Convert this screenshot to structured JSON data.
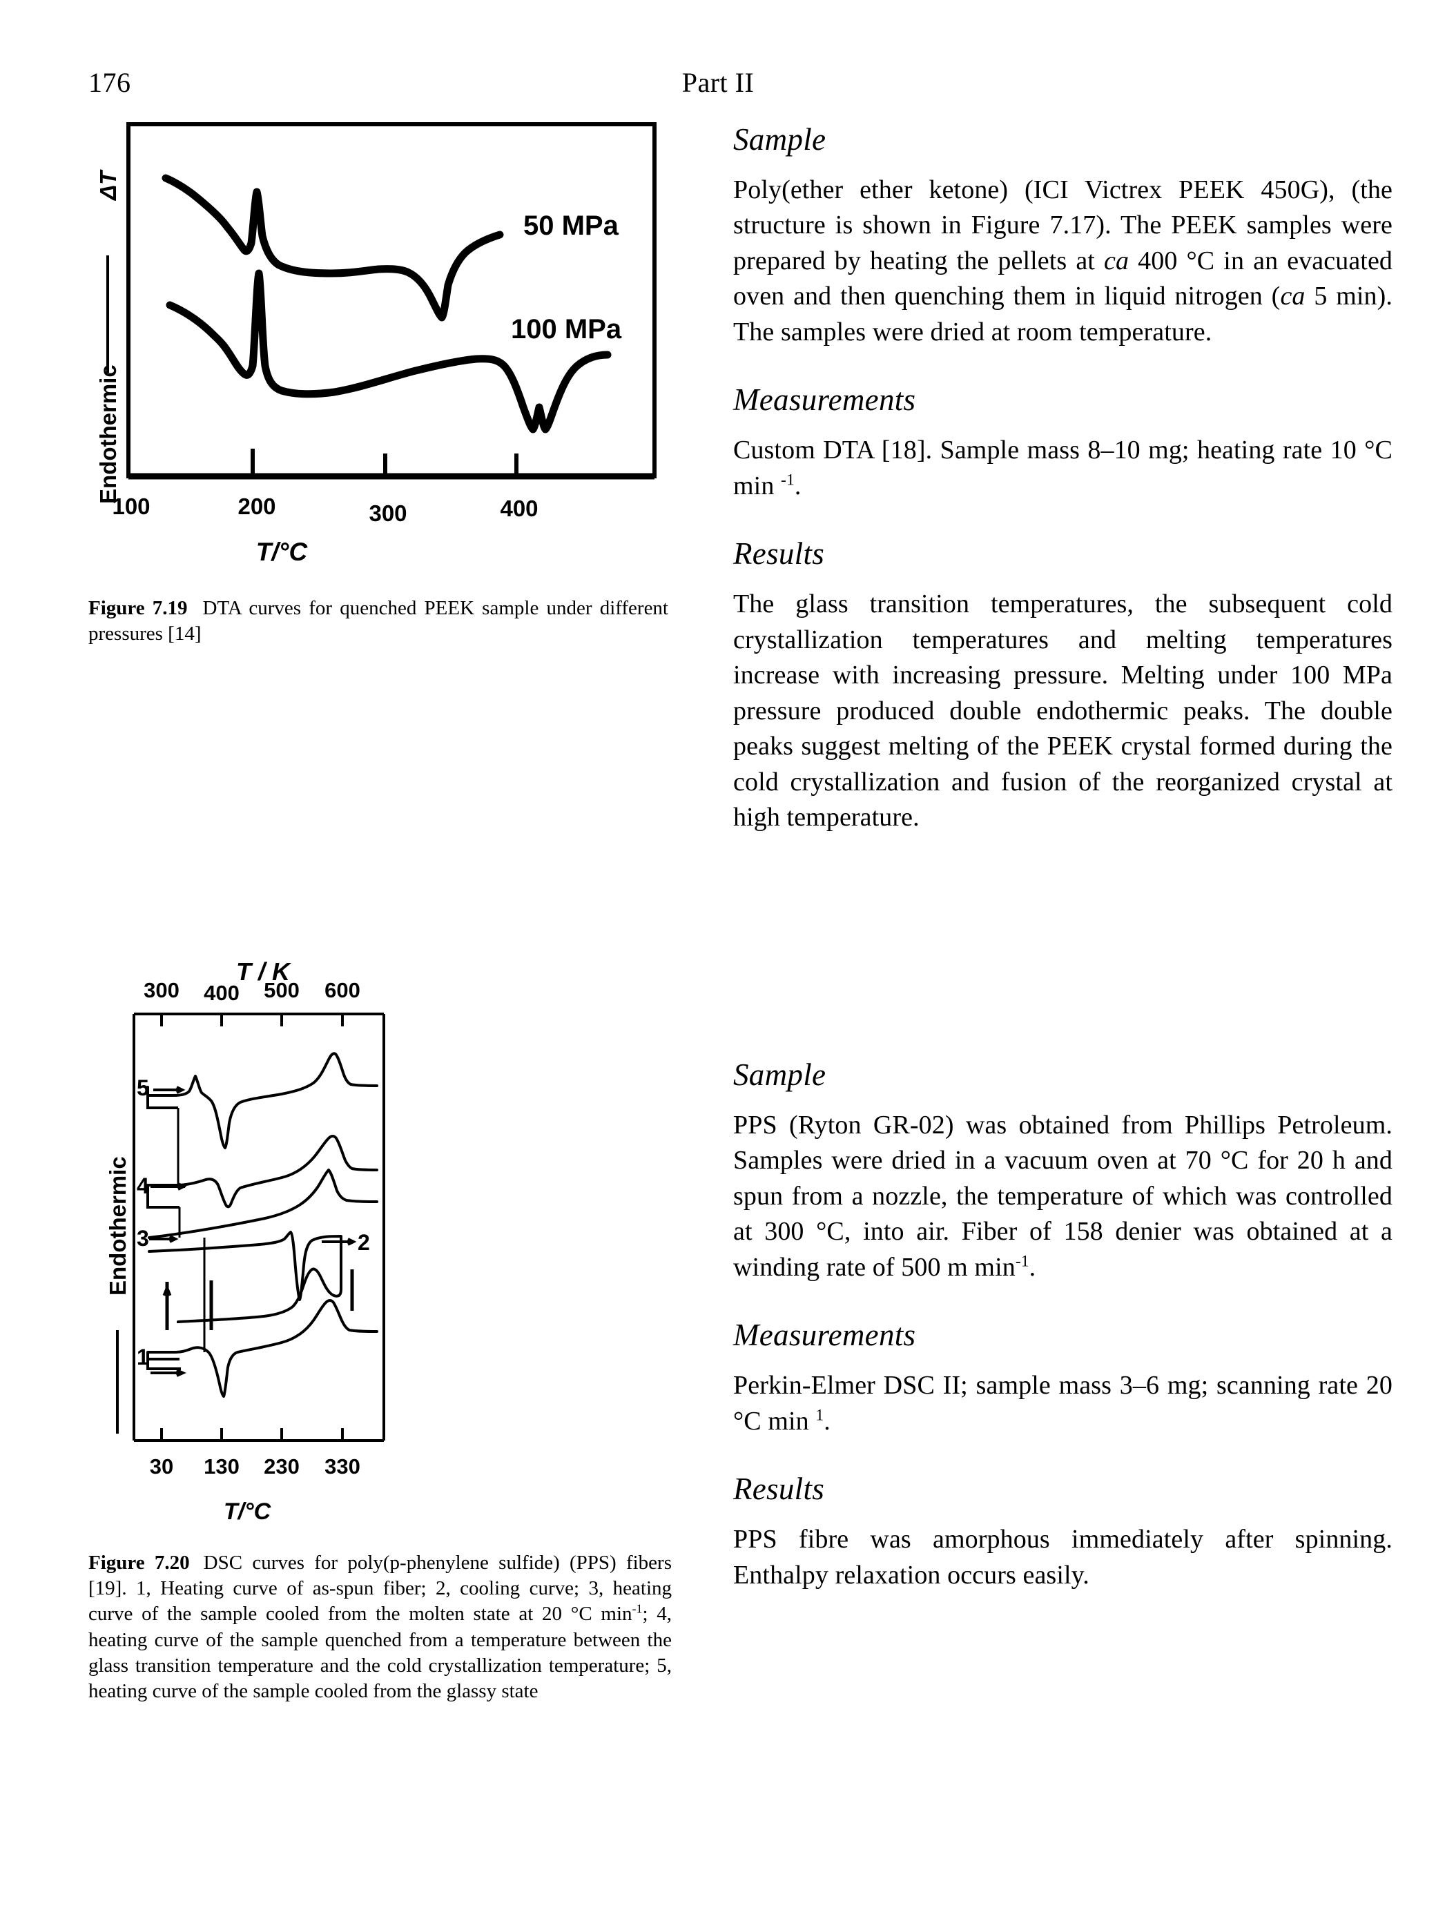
{
  "page": {
    "folio": "176",
    "running_head": "Part II"
  },
  "figures": [
    {
      "id": "fig-7-19",
      "caption_label": "Figure 7.19",
      "caption_text": "DTA curves for quenched PEEK sample under different pressures [14]",
      "y_axis_title": "Endothermic",
      "y_axis_symbol": "ΔT",
      "x_axis_title": "T/°C",
      "x_ticks": [
        "100",
        "200",
        "300",
        "400"
      ],
      "curve_labels": [
        "50 MPa",
        "100 MPa"
      ]
    },
    {
      "id": "fig-7-20",
      "caption_label": "Figure 7.20",
      "caption_text": "DSC curves for poly(p-phenylene sulfide) (PPS) fibers [19]. 1, Heating curve of as-spun fiber; 2, cooling curve; 3, heating curve of the sample cooled from the molten state at 20 °C min",
      "caption_text_2": "; 4, heating curve of the sample quenched from a temperature between the glass transition temperature and the cold crystallization temperature; 5, heating curve of the sample cooled from the glassy state",
      "caption_sup": "-1",
      "y_axis_title": "Endothermic",
      "x_axis_title_top": "T / K",
      "x_axis_title_bottom": "T/°C",
      "x_ticks_top": [
        "300",
        "400",
        "500",
        "600"
      ],
      "x_ticks_bottom": [
        "30",
        "130",
        "230",
        "330"
      ],
      "curve_labels": [
        "1",
        "2",
        "3",
        "4",
        "5"
      ]
    }
  ],
  "sections": [
    {
      "id": "peek-sample",
      "heading": "Sample",
      "paragraph_html": "Poly(ether ether ketone) (ICI Victrex PEEK 450G), (the structure is shown in Figure 7.17). The PEEK samples were prepared by heating the pellets at <i>ca</i> 400 °C in an evacuated oven and then quenching them in liquid nitrogen (<i>ca</i> 5 min). The samples were dried at room temperature."
    },
    {
      "id": "peek-measurements",
      "heading": "Measurements",
      "paragraph_html": "Custom DTA [18]. Sample mass 8–10 mg; heating rate 10 °C min <sup>-1</sup>."
    },
    {
      "id": "peek-results",
      "heading": "Results",
      "paragraph_html": "The glass transition temperatures, the subsequent cold crystallization temperatures and melting temperatures increase with increasing pressure. Melting under 100 MPa pressure produced double endothermic peaks. The double peaks suggest melting of the PEEK crystal formed during the cold crystallization and fusion of the reorganized crystal at high temperature."
    },
    {
      "id": "pps-sample",
      "heading": "Sample",
      "paragraph_html": "PPS (Ryton GR-02) was obtained from Phillips Petroleum. Samples were dried in a vacuum oven at 70 °C for 20 h and spun from a nozzle, the temperature of which was controlled at 300 °C, into air. Fiber of 158 denier was obtained at a winding rate of 500 m min<sup>-1</sup>."
    },
    {
      "id": "pps-measurements",
      "heading": "Measurements",
      "paragraph_html": "Perkin-Elmer DSC II; sample mass 3–6 mg; scanning rate 20 °C min <sup>1</sup>."
    },
    {
      "id": "pps-results",
      "heading": "Results",
      "paragraph_html": "PPS fibre was amorphous immediately after spinning. Enthalpy relaxation occurs easily."
    }
  ],
  "chart_data": [
    {
      "type": "line",
      "title": "DTA curves for quenched PEEK sample under different pressures",
      "xlabel": "T/°C",
      "ylabel": "Endothermic — ΔT",
      "xlim": [
        100,
        460
      ],
      "xticks": [
        100,
        200,
        300,
        400
      ],
      "grid": false,
      "legend_position": "inline-right",
      "series": [
        {
          "name": "50 MPa",
          "annotation": "50 MPa",
          "features": {
            "glass_transition_C": 165,
            "cold_crystallization_peak_C": 200,
            "melting_endotherm_C": 330
          },
          "x": [
            120,
            140,
            160,
            170,
            180,
            190,
            196,
            200,
            204,
            210,
            220,
            235,
            250,
            265,
            285,
            300,
            315,
            325,
            330,
            334,
            340,
            350,
            360
          ],
          "y": [
            0.82,
            0.75,
            0.68,
            0.62,
            0.55,
            0.5,
            0.62,
            0.86,
            0.6,
            0.46,
            0.38,
            0.34,
            0.33,
            0.34,
            0.35,
            0.34,
            0.28,
            0.15,
            0.04,
            0.12,
            0.32,
            0.45,
            0.52
          ]
        },
        {
          "name": "100 MPa",
          "annotation": "100 MPa",
          "features": {
            "glass_transition_C": 175,
            "cold_crystallization_peak_C": 207,
            "melting_endotherm_double_peaks_C": [
              385,
              398
            ]
          },
          "x": [
            120,
            140,
            160,
            172,
            185,
            195,
            202,
            206,
            210,
            216,
            228,
            245,
            265,
            290,
            315,
            335,
            352,
            362,
            370,
            378,
            384,
            389,
            394,
            399,
            405,
            415,
            425,
            435
          ],
          "y": [
            0.8,
            0.72,
            0.66,
            0.58,
            0.48,
            0.44,
            0.46,
            0.95,
            0.6,
            0.45,
            0.38,
            0.35,
            0.36,
            0.4,
            0.44,
            0.48,
            0.5,
            0.49,
            0.42,
            0.22,
            0.1,
            0.2,
            0.08,
            0.22,
            0.4,
            0.52,
            0.56,
            0.56
          ]
        }
      ]
    },
    {
      "type": "line",
      "title": "DSC curves for poly(p-phenylene sulfide) (PPS) fibers",
      "xlabel_top": "T / K",
      "xlabel_bottom": "T/°C",
      "ylabel": "Endothermic",
      "xlim_K": [
        290,
        620
      ],
      "xticks_K": [
        300,
        400,
        500,
        600
      ],
      "xlim_C": [
        17,
        347
      ],
      "xticks_C": [
        30,
        130,
        230,
        330
      ],
      "grid": false,
      "series": [
        {
          "name": "1",
          "description": "Heating curve of as-spun fiber",
          "features": {
            "glass_transition_C": 90,
            "cold_crystallization_peak_C": 130,
            "melting_peak_C": 280
          }
        },
        {
          "name": "2",
          "description": "Cooling curve",
          "features": {
            "crystallization_exotherm_C": 225
          }
        },
        {
          "name": "3",
          "description": "Heating curve of the sample cooled from the molten state at 20 °C min-1",
          "features": {
            "melting_peak_C": 280
          }
        },
        {
          "name": "4",
          "description": "Heating curve of the sample quenched from a temperature between the glass transition temperature and the cold crystallization temperature",
          "features": {
            "cold_crystallization_peak_C": 125,
            "melting_peak_C": 280
          }
        },
        {
          "name": "5",
          "description": "Heating curve of the sample cooled from the glassy state",
          "features": {
            "enthalpy_relaxation_peak_C": 95,
            "cold_crystallization_peak_C": 128,
            "melting_peak_C": 282
          }
        }
      ]
    }
  ]
}
